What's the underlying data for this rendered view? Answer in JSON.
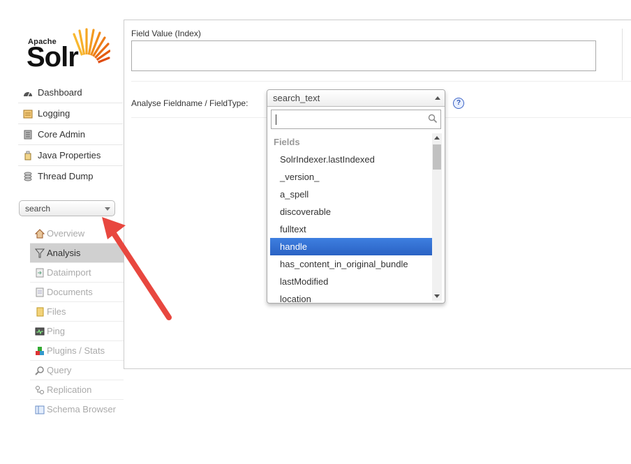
{
  "logo": {
    "apache": "Apache",
    "solr": "Solr"
  },
  "sidebar": {
    "items": [
      {
        "label": "Dashboard",
        "icon": "dashboard-icon"
      },
      {
        "label": "Logging",
        "icon": "logging-icon"
      },
      {
        "label": "Core Admin",
        "icon": "core-admin-icon"
      },
      {
        "label": "Java Properties",
        "icon": "java-properties-icon"
      },
      {
        "label": "Thread Dump",
        "icon": "thread-dump-icon"
      }
    ],
    "core_selector": {
      "value": "search"
    },
    "core_items": [
      {
        "label": "Overview",
        "icon": "overview-icon"
      },
      {
        "label": "Analysis",
        "icon": "analysis-icon",
        "active": true
      },
      {
        "label": "Dataimport",
        "icon": "dataimport-icon"
      },
      {
        "label": "Documents",
        "icon": "documents-icon"
      },
      {
        "label": "Files",
        "icon": "files-icon"
      },
      {
        "label": "Ping",
        "icon": "ping-icon"
      },
      {
        "label": "Plugins / Stats",
        "icon": "plugins-icon"
      },
      {
        "label": "Query",
        "icon": "query-icon"
      },
      {
        "label": "Replication",
        "icon": "replication-icon"
      },
      {
        "label": "Schema Browser",
        "icon": "schema-browser-icon"
      }
    ]
  },
  "main": {
    "field_value_label": "Field Value (Index)",
    "field_value": "",
    "analyse_label": "Analyse Fieldname / FieldType:",
    "help": "?"
  },
  "dropdown": {
    "selected": "search_text",
    "search_value": "",
    "group_label": "Fields",
    "options": [
      "SolrIndexer.lastIndexed",
      "_version_",
      "a_spell",
      "discoverable",
      "fulltext",
      "handle",
      "has_content_in_original_bundle",
      "lastModified",
      "location"
    ],
    "highlighted": "handle"
  },
  "colors": {
    "highlight": "#3875d7",
    "annotation_arrow": "#e8473f",
    "logo_orange": "#f07d18"
  }
}
